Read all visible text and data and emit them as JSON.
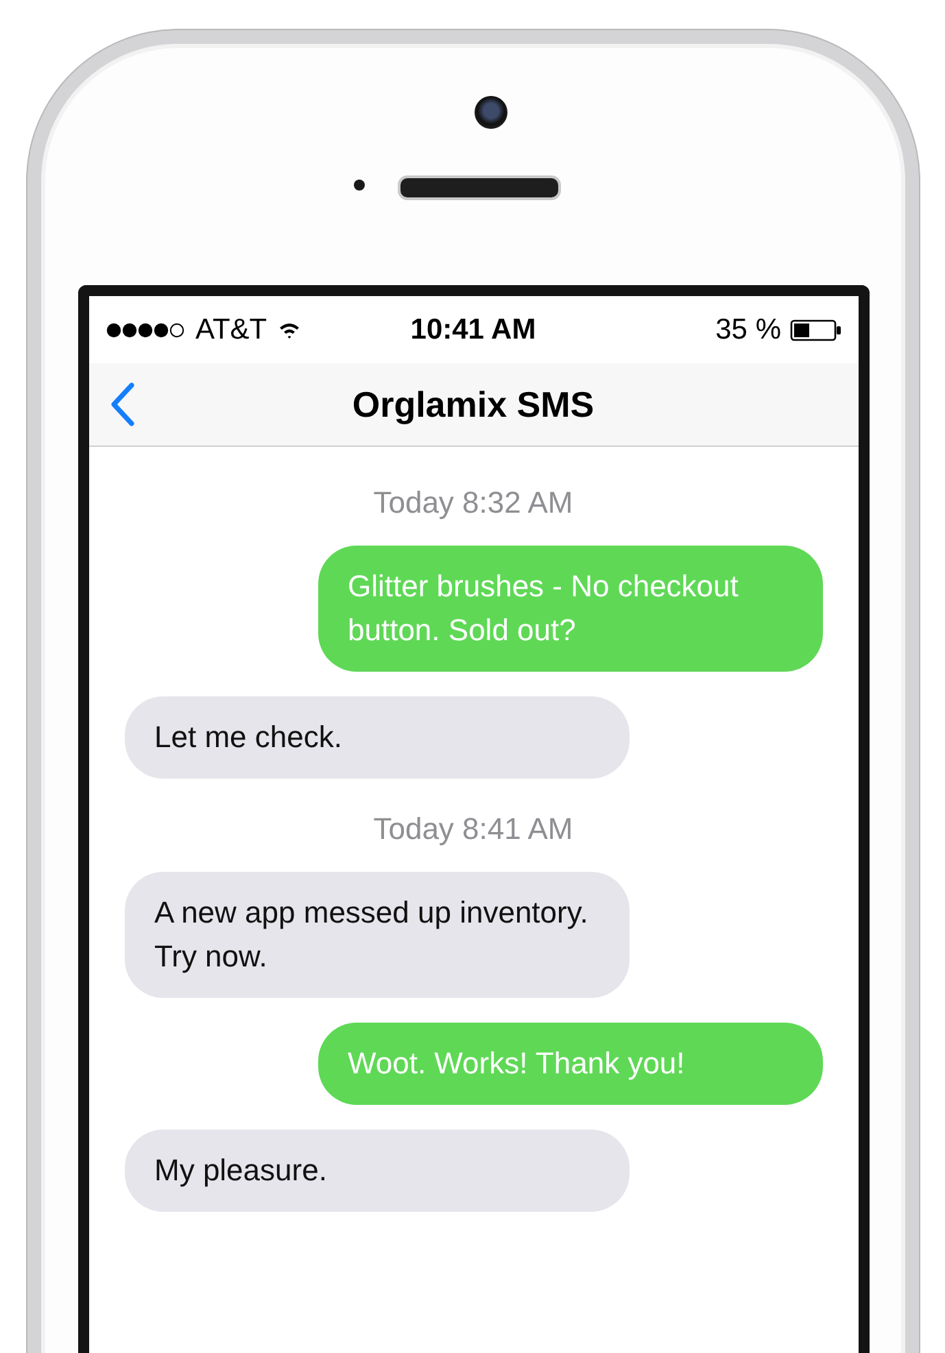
{
  "status_bar": {
    "carrier": "AT&T",
    "time": "10:41 AM",
    "battery": "35 %"
  },
  "nav": {
    "title": "Orglamix SMS"
  },
  "messages": [
    {
      "kind": "timestamp",
      "text": "Today 8:32 AM"
    },
    {
      "kind": "sent",
      "text": "Glitter brushes - No checkout button. Sold out?"
    },
    {
      "kind": "received",
      "text": "Let me check."
    },
    {
      "kind": "timestamp",
      "text": "Today 8:41 AM"
    },
    {
      "kind": "received",
      "text": "A new app messed up inventory. Try now."
    },
    {
      "kind": "sent",
      "text": "Woot. Works! Thank you!"
    },
    {
      "kind": "received",
      "text": "My pleasure."
    }
  ]
}
